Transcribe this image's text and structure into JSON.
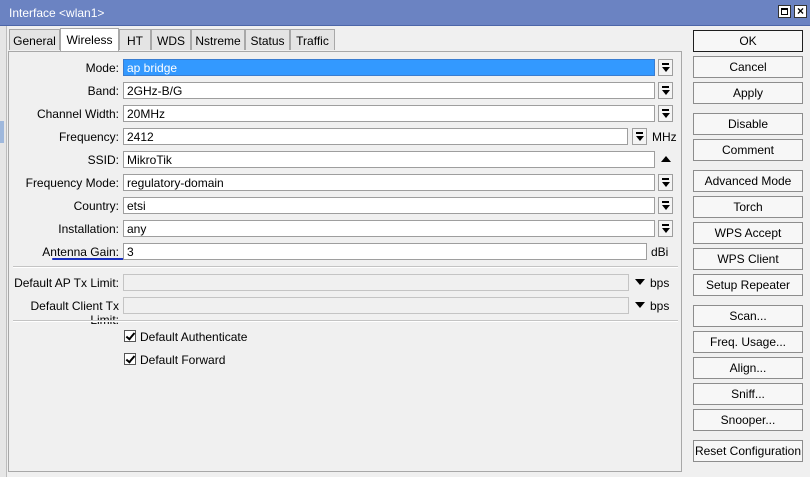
{
  "window": {
    "title": "Interface <wlan1>"
  },
  "tabs": [
    {
      "label": "General"
    },
    {
      "label": "Wireless"
    },
    {
      "label": "HT"
    },
    {
      "label": "WDS"
    },
    {
      "label": "Nstreme"
    },
    {
      "label": "Status"
    },
    {
      "label": "Traffic"
    }
  ],
  "active_tab": "Wireless",
  "fields": {
    "mode": {
      "label": "Mode:",
      "value": "ap bridge"
    },
    "band": {
      "label": "Band:",
      "value": "2GHz-B/G"
    },
    "channel_width": {
      "label": "Channel Width:",
      "value": "20MHz"
    },
    "frequency": {
      "label": "Frequency:",
      "value": "2412",
      "unit": "MHz"
    },
    "ssid": {
      "label": "SSID:",
      "value": "MikroTik"
    },
    "frequency_mode": {
      "label": "Frequency Mode:",
      "value": "regulatory-domain"
    },
    "country": {
      "label": "Country:",
      "value": "etsi"
    },
    "installation": {
      "label": "Installation:",
      "value": "any"
    },
    "antenna_gain": {
      "label": "Antenna Gain:",
      "value": "3",
      "unit": "dBi"
    },
    "default_ap_tx_limit": {
      "label": "Default AP Tx Limit:",
      "value": "",
      "unit": "bps"
    },
    "default_client_tx_limit": {
      "label": "Default Client Tx Limit:",
      "value": "",
      "unit": "bps"
    }
  },
  "checkboxes": {
    "default_authenticate": {
      "label": "Default Authenticate",
      "checked": true
    },
    "default_forward": {
      "label": "Default Forward",
      "checked": true
    }
  },
  "buttons": {
    "ok": "OK",
    "cancel": "Cancel",
    "apply": "Apply",
    "disable": "Disable",
    "comment": "Comment",
    "advanced_mode": "Advanced Mode",
    "torch": "Torch",
    "wps_accept": "WPS Accept",
    "wps_client": "WPS Client",
    "setup_repeater": "Setup Repeater",
    "scan": "Scan...",
    "freq_usage": "Freq. Usage...",
    "align": "Align...",
    "sniff": "Sniff...",
    "snooper": "Snooper...",
    "reset_configuration": "Reset Configuration"
  },
  "colors": {
    "titlebar": "#6b83c2",
    "selection": "#3399ff",
    "annotation_underline": "#1a2fbf"
  }
}
